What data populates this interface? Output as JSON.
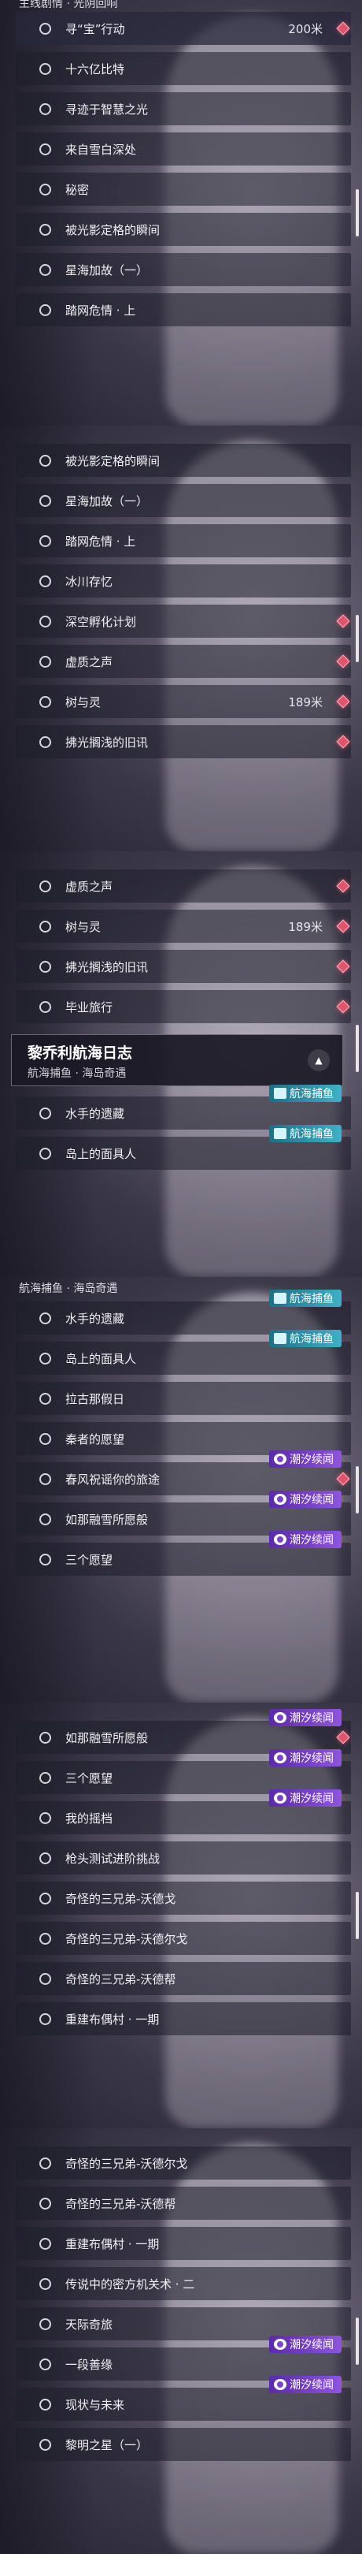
{
  "screens": [
    {
      "top_header": "主线剧情 · 光阴回响",
      "rows": [
        {
          "label": "寻“宝”行动",
          "dist": "200米",
          "diamond": true
        },
        {
          "label": "十六亿比特"
        },
        {
          "label": "寻迹于智慧之光"
        },
        {
          "label": "来自雪白深处"
        },
        {
          "label": "秘密"
        },
        {
          "label": "被光影定格的瞬间"
        },
        {
          "label": "星海加故（一）"
        },
        {
          "label": "踏网危情 · 上"
        }
      ]
    },
    {
      "rows": [
        {
          "label": "被光影定格的瞬间"
        },
        {
          "label": "星海加故（一）"
        },
        {
          "label": "踏网危情 · 上"
        },
        {
          "label": "冰川存忆"
        },
        {
          "label": "深空孵化计划",
          "diamond": true
        },
        {
          "label": "虚质之声",
          "diamond": true
        },
        {
          "label": "树与灵",
          "dist": "189米",
          "diamond": true
        },
        {
          "label": "拂光搁浅的旧讯",
          "diamond": true
        }
      ]
    },
    {
      "rows": [
        {
          "label": "虚质之声",
          "diamond": true
        },
        {
          "label": "树与灵",
          "dist": "189米",
          "diamond": true
        },
        {
          "label": "拂光搁浅的旧讯",
          "diamond": true
        },
        {
          "label": "毕业旅行",
          "diamond": true
        }
      ],
      "section": {
        "title": "黎乔利航海日志",
        "subtitle": "航海捕鱼 · 海岛奇遇",
        "toggle": "▲"
      },
      "rows2": [
        {
          "label": "水手的遗藏",
          "tag": "航海捕鱼"
        },
        {
          "label": "岛上的面具人",
          "tag": "航海捕鱼"
        }
      ]
    },
    {
      "subhead": "航海捕鱼 · 海岛奇遇",
      "rows": [
        {
          "label": "水手的遗藏",
          "tag": "航海捕鱼"
        },
        {
          "label": "岛上的面具人",
          "tag": "航海捕鱼"
        },
        {
          "label": "拉古那假日"
        },
        {
          "label": "秦者的愿望"
        },
        {
          "label": "春风祝谣你的旅途",
          "tag": "潮汐续闻",
          "diamond": true
        },
        {
          "label": "如那融雪所愿般",
          "tag": "潮汐续闻"
        },
        {
          "label": "三个愿望",
          "tag": "潮汐续闻"
        }
      ]
    },
    {
      "rows": [
        {
          "label": "如那融雪所愿般",
          "tag": "潮汐续闻",
          "diamond": true
        },
        {
          "label": "三个愿望",
          "tag": "潮汐续闻"
        },
        {
          "label": "我的摇档",
          "tag": "潮汐续闻"
        },
        {
          "label": "枪头测试进阶挑战"
        },
        {
          "label": "奇怪的三兄弟-沃德戈"
        },
        {
          "label": "奇怪的三兄弟-沃德尔戈"
        },
        {
          "label": "奇怪的三兄弟-沃德帮"
        },
        {
          "label": "重建布偶村 · 一期"
        }
      ]
    },
    {
      "rows": [
        {
          "label": "奇怪的三兄弟-沃德尔戈"
        },
        {
          "label": "奇怪的三兄弟-沃德帮"
        },
        {
          "label": "重建布偶村 · 一期"
        },
        {
          "label": "传说中的密方机关术 · 二"
        },
        {
          "label": "天际奇旅"
        },
        {
          "label": "一段善缘",
          "tag": "潮汐续闻"
        },
        {
          "label": "现状与未来",
          "tag": "潮汐续闻"
        },
        {
          "label": "黎明之星（一）"
        }
      ]
    }
  ],
  "tag_colors": {
    "潮汐续闻": "#7a44cc",
    "航海捕鱼": "#2f94ad"
  },
  "accent_diamond": "#e0556b"
}
